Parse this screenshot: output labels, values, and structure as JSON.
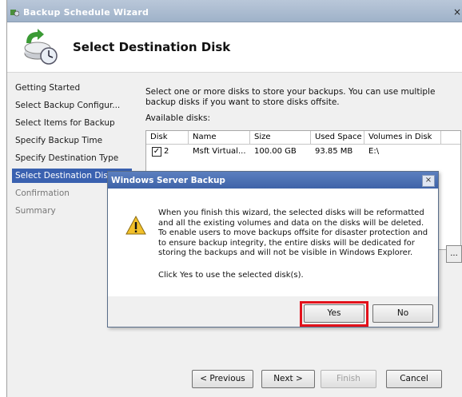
{
  "window": {
    "title": "Backup Schedule Wizard",
    "close_glyph": "×",
    "header_title": "Select Destination Disk",
    "header_icon": "backup-clock-icon"
  },
  "steps": [
    {
      "label": "Getting Started",
      "state": "normal"
    },
    {
      "label": "Select Backup Configur...",
      "state": "normal"
    },
    {
      "label": "Select Items for Backup",
      "state": "normal"
    },
    {
      "label": "Specify Backup Time",
      "state": "normal"
    },
    {
      "label": "Specify Destination Type",
      "state": "normal"
    },
    {
      "label": "Select Destination Disk",
      "state": "selected"
    },
    {
      "label": "Confirmation",
      "state": "dim"
    },
    {
      "label": "Summary",
      "state": "dim"
    }
  ],
  "content": {
    "description": "Select one or more disks to store your backups. You can use multiple backup disks if you want to store disks offsite.",
    "available_label": "Available disks:",
    "columns": [
      "Disk",
      "Name",
      "Size",
      "Used Space",
      "Volumes in Disk"
    ],
    "rows": [
      {
        "checked": true,
        "disk": "2",
        "name": "Msft Virtual...",
        "size": "100.00 GB",
        "used": "93.85 MB",
        "volumes": "E:\\"
      }
    ],
    "check_glyph": "✓",
    "side_button": "..."
  },
  "footer": {
    "previous": "< Previous",
    "next": "Next >",
    "finish": "Finish",
    "cancel": "Cancel"
  },
  "dialog": {
    "title": "Windows Server Backup",
    "close_glyph": "×",
    "icon": "warning-icon",
    "message": "When you finish this wizard, the selected disks will be reformatted and all the existing volumes and data on the disks will be deleted. To enable users to move backups offsite for disaster protection and to ensure backup integrity, the entire disks will be dedicated for storing the backups and will not be visible in Windows Explorer.",
    "prompt": "Click Yes to use the selected disk(s).",
    "yes": "Yes",
    "no": "No",
    "highlight_color": "#e3111b"
  }
}
